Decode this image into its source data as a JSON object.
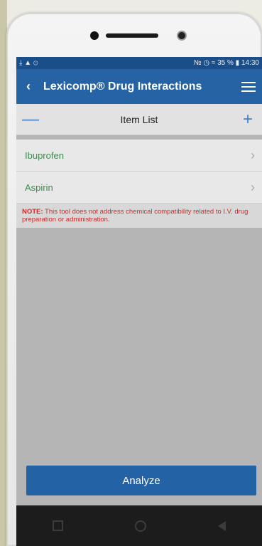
{
  "statusbar": {
    "left_icons": "⤓ ▲ ⊙",
    "right_icons": "№ ◷ ≈",
    "signal": "35 %",
    "time": "14:30"
  },
  "appbar": {
    "back_icon": "‹",
    "title": "Lexicomp® Drug Interactions"
  },
  "listbar": {
    "minus_icon": "—",
    "title": "Item List",
    "plus_icon": "+"
  },
  "items": [
    {
      "name": "Ibuprofen",
      "chev": "›"
    },
    {
      "name": "Aspirin",
      "chev": "›"
    }
  ],
  "note": {
    "label": "NOTE:",
    "text": " This tool does not address chemical compatibility related to I.V. drug preparation or administration."
  },
  "analyze_label": "Analyze",
  "colors": {
    "appbar": "#2563a5",
    "statusbar": "#1a4e88",
    "drug_name": "#3f8a4f",
    "note": "#d12b2b",
    "button": "#2462a6"
  }
}
